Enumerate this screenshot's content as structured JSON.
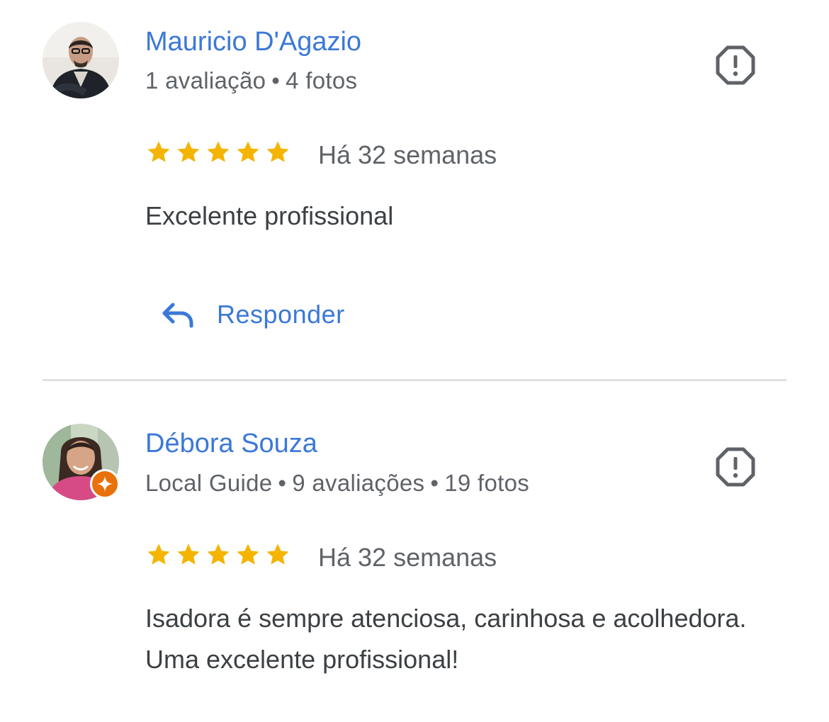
{
  "colors": {
    "link": "#3b78d8",
    "star": "#f4b400",
    "meta": "#5f6368",
    "text": "#3c4043",
    "divider": "#e0e0e0",
    "local_guide_badge": "#e8710a"
  },
  "reviews": [
    {
      "author": "Mauricio D'Agazio",
      "meta": [
        "1 avaliação",
        "4 fotos"
      ],
      "rating": 5,
      "date": "Há 32 semanas",
      "text": "Excelente profissional",
      "reply_label": "Responder",
      "flag_icon": "flag-report-icon"
    },
    {
      "author": "Débora Souza",
      "meta": [
        "Local Guide",
        "9 avaliações",
        "19 fotos"
      ],
      "rating": 5,
      "date": "Há 32 semanas",
      "text": "Isadora é sempre atenciosa, carinhosa e acolhedora. Uma excelente profissional!",
      "flag_icon": "flag-report-icon"
    }
  ],
  "separator": "•"
}
